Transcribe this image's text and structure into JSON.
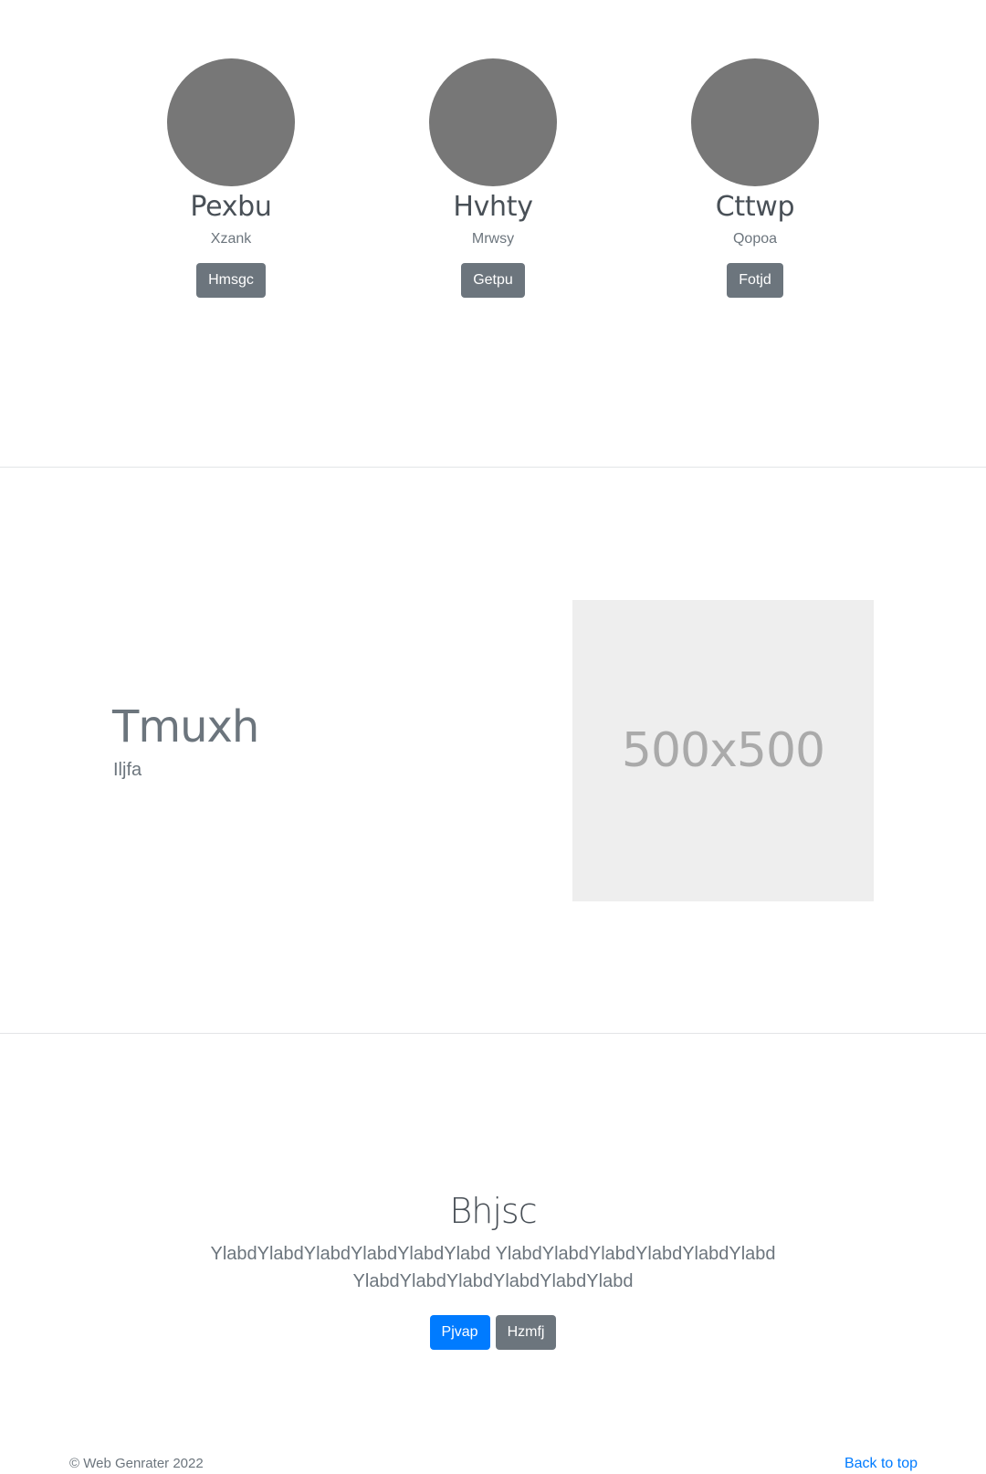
{
  "team": {
    "members": [
      {
        "name": "Pexbu",
        "role": "Xzank",
        "button": "Hmsgc"
      },
      {
        "name": "Hvhty",
        "role": "Mrwsy",
        "button": "Getpu"
      },
      {
        "name": "Cttwp",
        "role": "Qopoa",
        "button": "Fotjd"
      }
    ]
  },
  "feature": {
    "title": "Tmuxh",
    "subtitle": "Iljfa",
    "placeholder_label": "500x500"
  },
  "jumbotron": {
    "title": "Bhjsc",
    "lead": "YlabdYlabdYlabdYlabdYlabdYlabd YlabdYlabdYlabdYlabdYlabdYlabd YlabdYlabdYlabdYlabdYlabdYlabd",
    "primary_button": "Pjvap",
    "secondary_button": "Hzmfj"
  },
  "footer": {
    "copyright": "© Web Genrater 2022",
    "back_to_top": "Back to top"
  },
  "colors": {
    "primary": "#007bff",
    "secondary": "#6c757d",
    "avatar": "#777777",
    "placeholder_bg": "#eeeeee"
  }
}
